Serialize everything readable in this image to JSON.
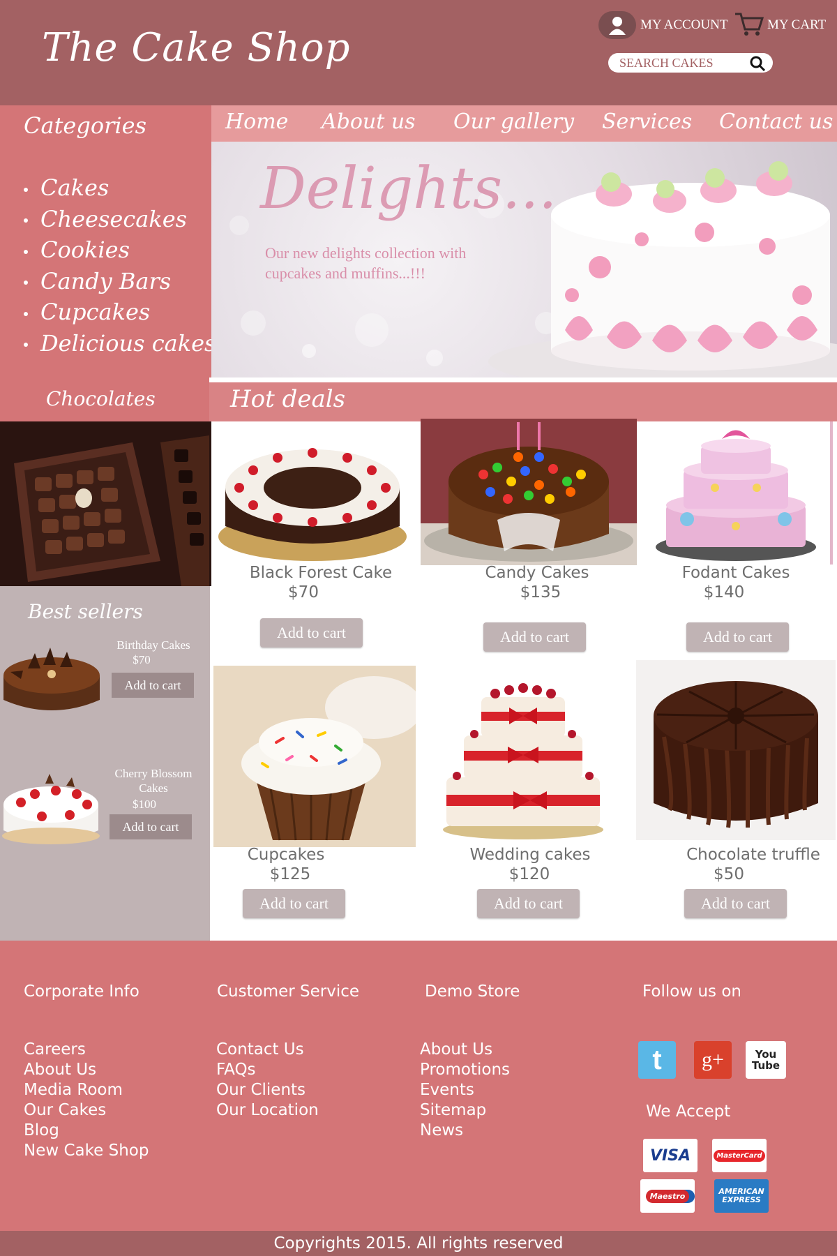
{
  "header": {
    "logo": "The Cake Shop",
    "account_label": "MY ACCOUNT",
    "cart_label": "MY  CART",
    "search_placeholder": "SEARCH CAKES"
  },
  "sidebar": {
    "categories_title": "Categories",
    "categories": [
      "Cakes",
      "Cheesecakes",
      "Cookies",
      "Candy Bars",
      "Cupcakes",
      "Delicious cakes"
    ],
    "chocolates_title": "Chocolates",
    "best_sellers_title": "Best sellers",
    "best_sellers": [
      {
        "name": "Birthday Cakes",
        "price": "$70",
        "button": "Add to cart"
      },
      {
        "name": "Cherry Blossom Cakes",
        "price": "$100",
        "button": "Add to cart"
      }
    ]
  },
  "nav": {
    "items": [
      "Home",
      "About us",
      "Our gallery",
      "Services",
      "Contact us"
    ]
  },
  "banner": {
    "title": "Delights...",
    "text": "Our new delights collection with cupcakes and muffins...!!!"
  },
  "deals": {
    "title": "Hot deals",
    "products": [
      {
        "name": "Black Forest Cake",
        "price": "$70",
        "button": "Add to cart"
      },
      {
        "name": "Candy Cakes",
        "price": "$135",
        "button": "Add to cart"
      },
      {
        "name": "Fodant Cakes",
        "price": "$140",
        "button": "Add to cart"
      },
      {
        "name": "Cupcakes",
        "price": "$125",
        "button": "Add to cart"
      },
      {
        "name": "Wedding cakes",
        "price": "$120",
        "button": "Add to cart"
      },
      {
        "name": "Chocolate truffle",
        "price": "$50",
        "button": "Add to cart"
      }
    ]
  },
  "footer": {
    "corporate_title": "Corporate Info",
    "corporate_links": [
      "Careers",
      "About Us",
      "Media Room",
      "Our Cakes",
      "Blog",
      "New Cake Shop"
    ],
    "service_title": "Customer Service",
    "service_links": [
      "Contact Us",
      "FAQs",
      "Our Clients",
      "Our Location"
    ],
    "demo_title": "Demo Store",
    "demo_links": [
      "About Us",
      "Promotions",
      "Events",
      "Sitemap",
      "News"
    ],
    "follow_title": "Follow us on",
    "social": [
      {
        "icon": "twitter-icon",
        "label": "t"
      },
      {
        "icon": "google-plus-icon",
        "label": "g+"
      },
      {
        "icon": "youtube-icon",
        "label": "You Tube"
      }
    ],
    "accept_title": "We Accept",
    "cards": [
      "VISA",
      "MasterCard",
      "Maestro",
      "AMERICAN EXPRESS"
    ],
    "copyright": "Copyrights  2015. All rights reserved"
  },
  "colors": {
    "header_bg": "#a36163",
    "sidebar_bg": "#d47577",
    "nav_bg": "#e69b9c",
    "best_bg": "#c0b3b4",
    "button_bg": "#c0b3b4"
  }
}
